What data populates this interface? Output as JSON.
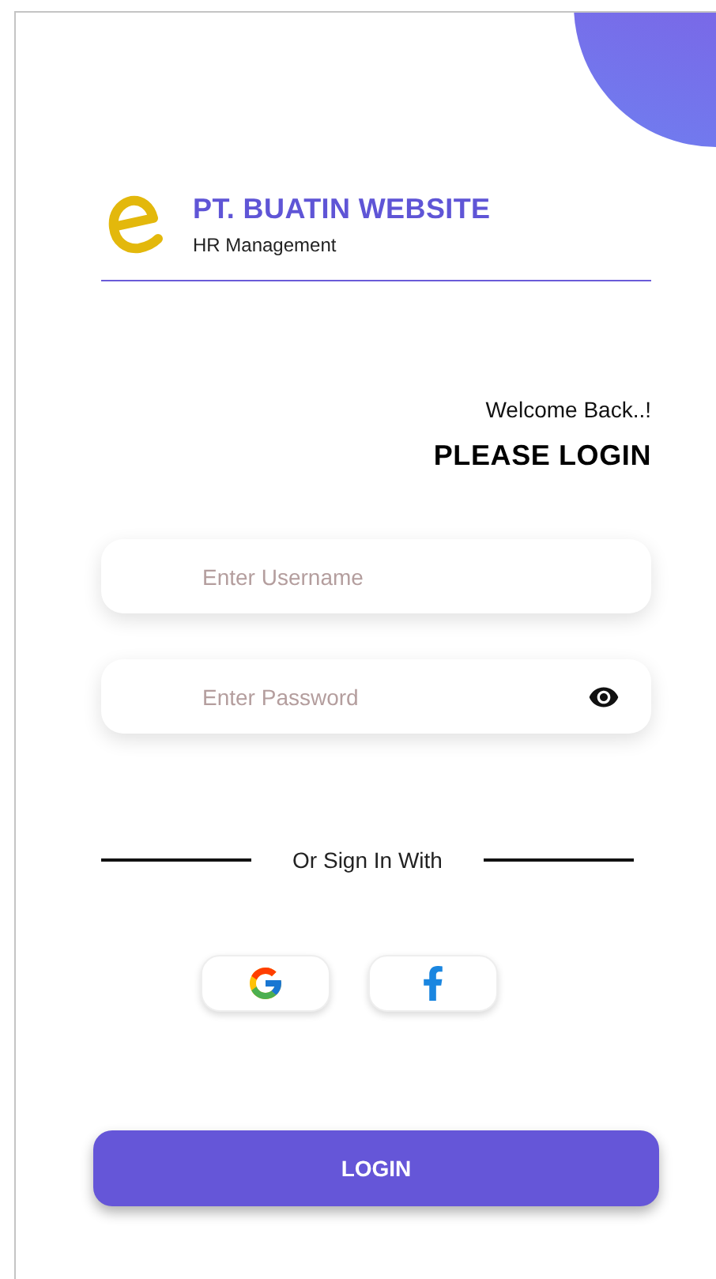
{
  "brand": {
    "title": "PT. BUATIN WEBSITE",
    "subtitle": "HR Management"
  },
  "welcome": "Welcome Back..!",
  "heading": "PLEASE LOGIN",
  "fields": [
    {
      "kind": "text",
      "placeholder": "Enter Username"
    },
    {
      "kind": "password",
      "placeholder": "Enter Password"
    }
  ],
  "divider_text": "Or Sign In With",
  "social_buttons": [
    {
      "kind": "google"
    },
    {
      "kind": "facebook"
    }
  ],
  "login_button": "LOGIN"
}
